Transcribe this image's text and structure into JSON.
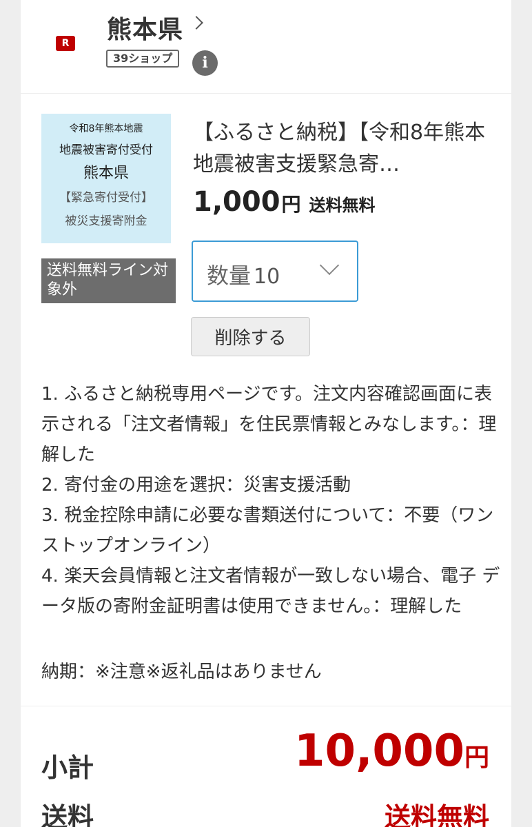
{
  "shop": {
    "logo_text": "R",
    "name": "熊本県",
    "badge": "39ショップ",
    "info_glyph": "i"
  },
  "item": {
    "thumbnail": {
      "line1": "令和8年熊本地震",
      "line2": "地震被害寄付受付",
      "line3": "熊本県",
      "line4": "【緊急寄付受付】",
      "line5": "被災支援寄附金"
    },
    "shipping_tag": "送料無料ライン対象外",
    "title": "【ふるさと納税】【令和8年熊本地震被害支援緊急寄…",
    "price": "1,000",
    "price_unit": "円",
    "price_shipping": "送料無料",
    "quantity_label": "数量",
    "quantity_value": "10",
    "delete_label": "削除する",
    "options": [
      "1. ふるさと納税専用ページです。注文内容確認画面に表 示される「注文者情報」を住民票情報とみなします。：理解した",
      "2. 寄付金の用途を選択：災害支援活動",
      "3. 税金控除申請に必要な書類送付について：不要（ワンストップオンライン）",
      "4. 楽天会員情報と注文者情報が一致しない場合、電子 データ版の寄附金証明書は使用できません。：理解した"
    ],
    "delivery": "納期：※注意※返礼品はありません"
  },
  "totals": {
    "subtotal_label": "小計",
    "subtotal_value": "10,000",
    "subtotal_unit": "円",
    "shipping_label": "送料",
    "shipping_value": "送料無料"
  },
  "colors": {
    "accent_red": "#bf0000",
    "select_border": "#3b9bd5",
    "tag_gray": "#6d6d6d",
    "thumb_bg": "#d2edf7"
  }
}
